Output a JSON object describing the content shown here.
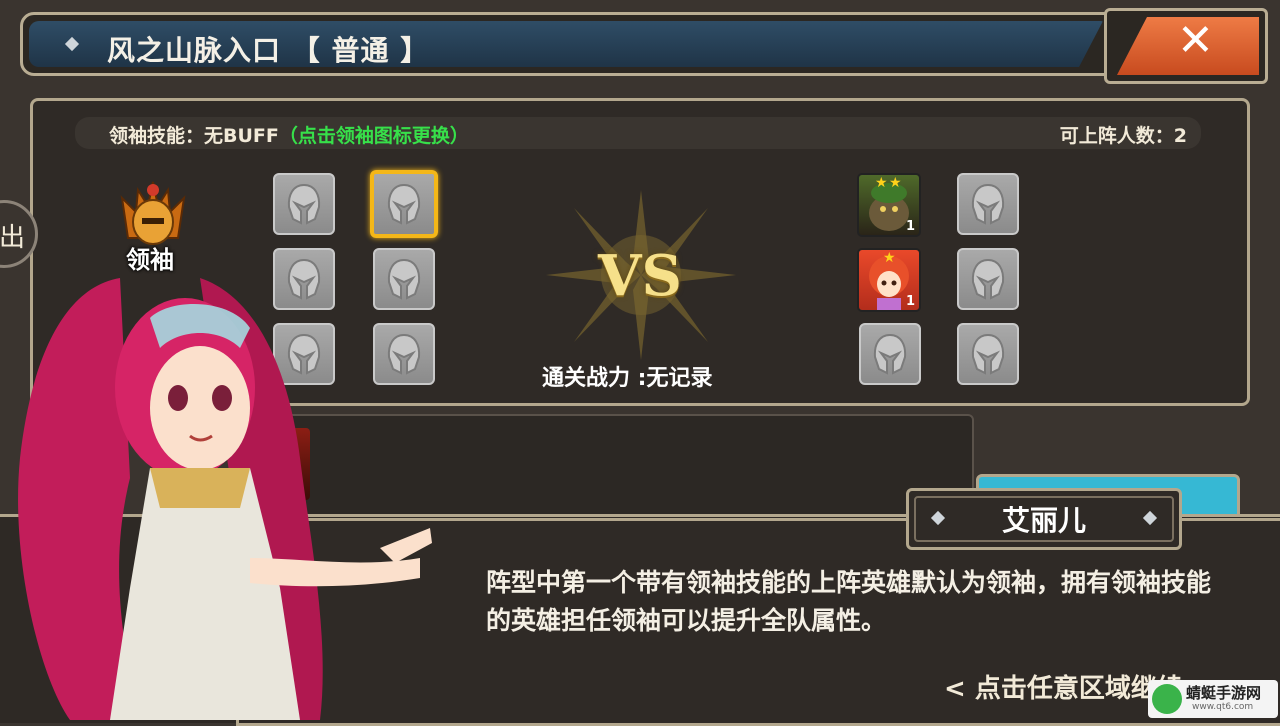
{
  "header": {
    "title": "风之山脉入口 【 普通 】"
  },
  "info": {
    "leader_skill_label": "领袖技能：",
    "leader_skill_value": "无BUFF",
    "leader_skill_hint": "（点击领袖图标更换）",
    "deploy_count_label": "可上阵人数：2"
  },
  "leader": {
    "label": "领袖"
  },
  "battle": {
    "vs": "VS",
    "power_label": "通关战力 :无记录"
  },
  "enemies": [
    {
      "level": "1",
      "stars": 2
    },
    {
      "level": "1",
      "stars": 1
    }
  ],
  "dialog": {
    "speaker": "艾丽儿",
    "text": "阵型中第一个带有领袖技能的上阵英雄默认为领袖，拥有领袖技能的英雄担任领袖可以提升全队属性。",
    "continue": "< 点击任意区域继续 >"
  },
  "watermark": {
    "text": "蜻蜓手游网",
    "sub": "www.qt6.com"
  },
  "colors": {
    "hint_green": "#37e04a",
    "title_blue": "#2f4d66",
    "close_orange": "#e0622f",
    "selected_gold": "#f4b718"
  },
  "icons": [
    "close-icon",
    "helmet-icon",
    "leader-helmet-icon"
  ]
}
